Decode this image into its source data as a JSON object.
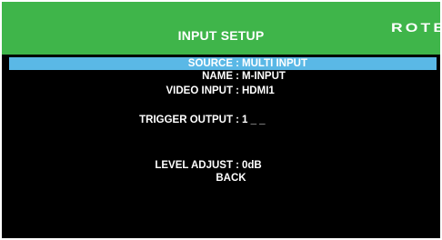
{
  "header": {
    "title": "INPUT SETUP",
    "brand": "ROTEL"
  },
  "menu": {
    "items": [
      {
        "label": "SOURCE",
        "separator": ":",
        "value": "MULTI INPUT",
        "selected": true
      },
      {
        "label": "NAME",
        "separator": ":",
        "value": "M-INPUT",
        "selected": false
      },
      {
        "label": "VIDEO INPUT",
        "separator": ":",
        "value": "HDMI1",
        "selected": false
      },
      {
        "label": "TRIGGER OUTPUT",
        "separator": ":",
        "value": "1 _ _",
        "selected": false
      },
      {
        "label": "LEVEL ADJUST",
        "separator": ":",
        "value": "0dB",
        "selected": false
      }
    ],
    "back_label": "BACK"
  },
  "colors": {
    "header_bg": "#3fb54a",
    "screen_bg": "#000000",
    "highlight": "#5ab8e6",
    "text": "#ffffff"
  }
}
